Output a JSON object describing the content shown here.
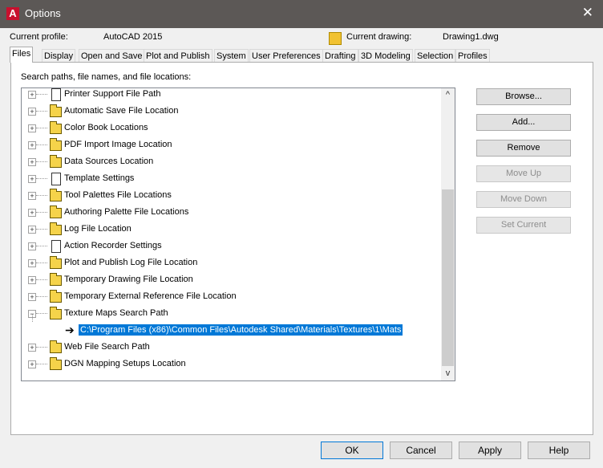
{
  "window": {
    "title": "Options",
    "app_icon_letter": "A",
    "close_glyph": "✕"
  },
  "profile": {
    "current_profile_label": "Current profile:",
    "current_profile_value": "AutoCAD 2015",
    "current_drawing_label": "Current drawing:",
    "current_drawing_value": "Drawing1.dwg"
  },
  "tabs": [
    "Files",
    "Display",
    "Open and Save",
    "Plot and Publish",
    "System",
    "User Preferences",
    "Drafting",
    "3D Modeling",
    "Selection",
    "Profiles"
  ],
  "active_tab": "Files",
  "files": {
    "search_label": "Search paths, file names, and file locations:",
    "tree": [
      {
        "label": "Printer Support File Path",
        "icon": "page-icon",
        "expander": "+"
      },
      {
        "label": "Automatic Save File Location",
        "icon": "folder-icon",
        "expander": "+"
      },
      {
        "label": "Color Book Locations",
        "icon": "folder-icon",
        "expander": "+"
      },
      {
        "label": "PDF Import Image Location",
        "icon": "folder-icon",
        "expander": "+"
      },
      {
        "label": "Data Sources Location",
        "icon": "folder-icon",
        "expander": "+"
      },
      {
        "label": "Template Settings",
        "icon": "page-icon",
        "expander": "+"
      },
      {
        "label": "Tool Palettes File Locations",
        "icon": "folder-icon",
        "expander": "+"
      },
      {
        "label": "Authoring Palette File Locations",
        "icon": "folder-icon",
        "expander": "+"
      },
      {
        "label": "Log File Location",
        "icon": "folder-icon",
        "expander": "+"
      },
      {
        "label": "Action Recorder Settings",
        "icon": "page-icon",
        "expander": "+"
      },
      {
        "label": "Plot and Publish Log File Location",
        "icon": "folder-icon",
        "expander": "+"
      },
      {
        "label": "Temporary Drawing File Location",
        "icon": "folder-icon",
        "expander": "+"
      },
      {
        "label": "Temporary External Reference File Location",
        "icon": "folder-icon",
        "expander": "+"
      },
      {
        "label": "Texture Maps Search Path",
        "icon": "folder-icon",
        "expander": "−"
      },
      {
        "label": "Web File Search Path",
        "icon": "folder-icon",
        "expander": "+"
      },
      {
        "label": "DGN Mapping Setups Location",
        "icon": "folder-icon",
        "expander": "+"
      }
    ],
    "selected_child": {
      "arrow": "➔",
      "path": "C:\\Program Files (x86)\\Common Files\\Autodesk Shared\\Materials\\Textures\\1\\Mats"
    },
    "scroll_up": "^",
    "scroll_down": "v",
    "side_buttons": [
      {
        "label": "Browse...",
        "enabled": true
      },
      {
        "label": "Add...",
        "enabled": true
      },
      {
        "label": "Remove",
        "enabled": true
      },
      {
        "label": "Move Up",
        "enabled": false
      },
      {
        "label": "Move Down",
        "enabled": false
      },
      {
        "label": "Set Current",
        "enabled": false
      }
    ]
  },
  "footer": {
    "ok": "OK",
    "cancel": "Cancel",
    "apply": "Apply",
    "help": "Help"
  },
  "colors": {
    "selection": "#0078d7",
    "titlebar": "#5c5856",
    "folder": "#f5d34a"
  }
}
